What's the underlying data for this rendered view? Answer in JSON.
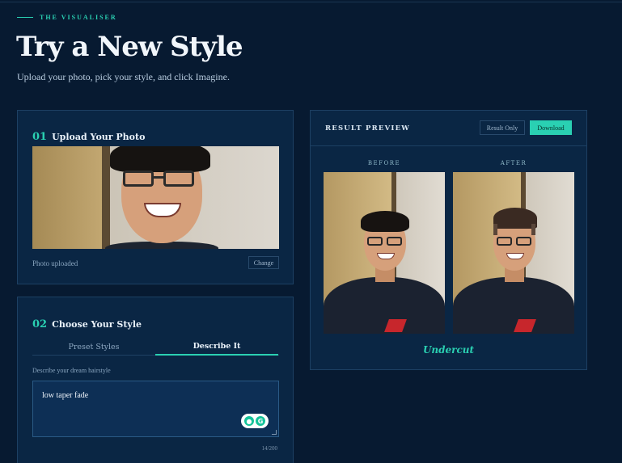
{
  "header": {
    "eyebrow": "THE VISUALISER",
    "title": "Try a New Style",
    "subtitle": "Upload your photo, pick your style, and click Imagine."
  },
  "upload": {
    "step_num": "01",
    "step_label": "Upload Your Photo",
    "status": "Photo uploaded",
    "change_label": "Change"
  },
  "style": {
    "step_num": "02",
    "step_label": "Choose Your Style",
    "tabs": [
      {
        "label": "Preset Styles",
        "active": false
      },
      {
        "label": "Describe It",
        "active": true
      }
    ],
    "describe_label": "Describe your dream hairstyle",
    "describe_value": "low taper fade",
    "char_count": "14/200"
  },
  "result": {
    "title": "RESULT PREVIEW",
    "result_only_label": "Result Only",
    "download_label": "Download",
    "before_label": "BEFORE",
    "after_label": "AFTER",
    "style_name": "Undercut"
  },
  "colors": {
    "background": "#071a31",
    "panel": "#0a2644",
    "accent": "#2ad0b2"
  },
  "icons": {
    "grammarly": "grammarly-icon",
    "resize": "resize-handle-icon"
  }
}
